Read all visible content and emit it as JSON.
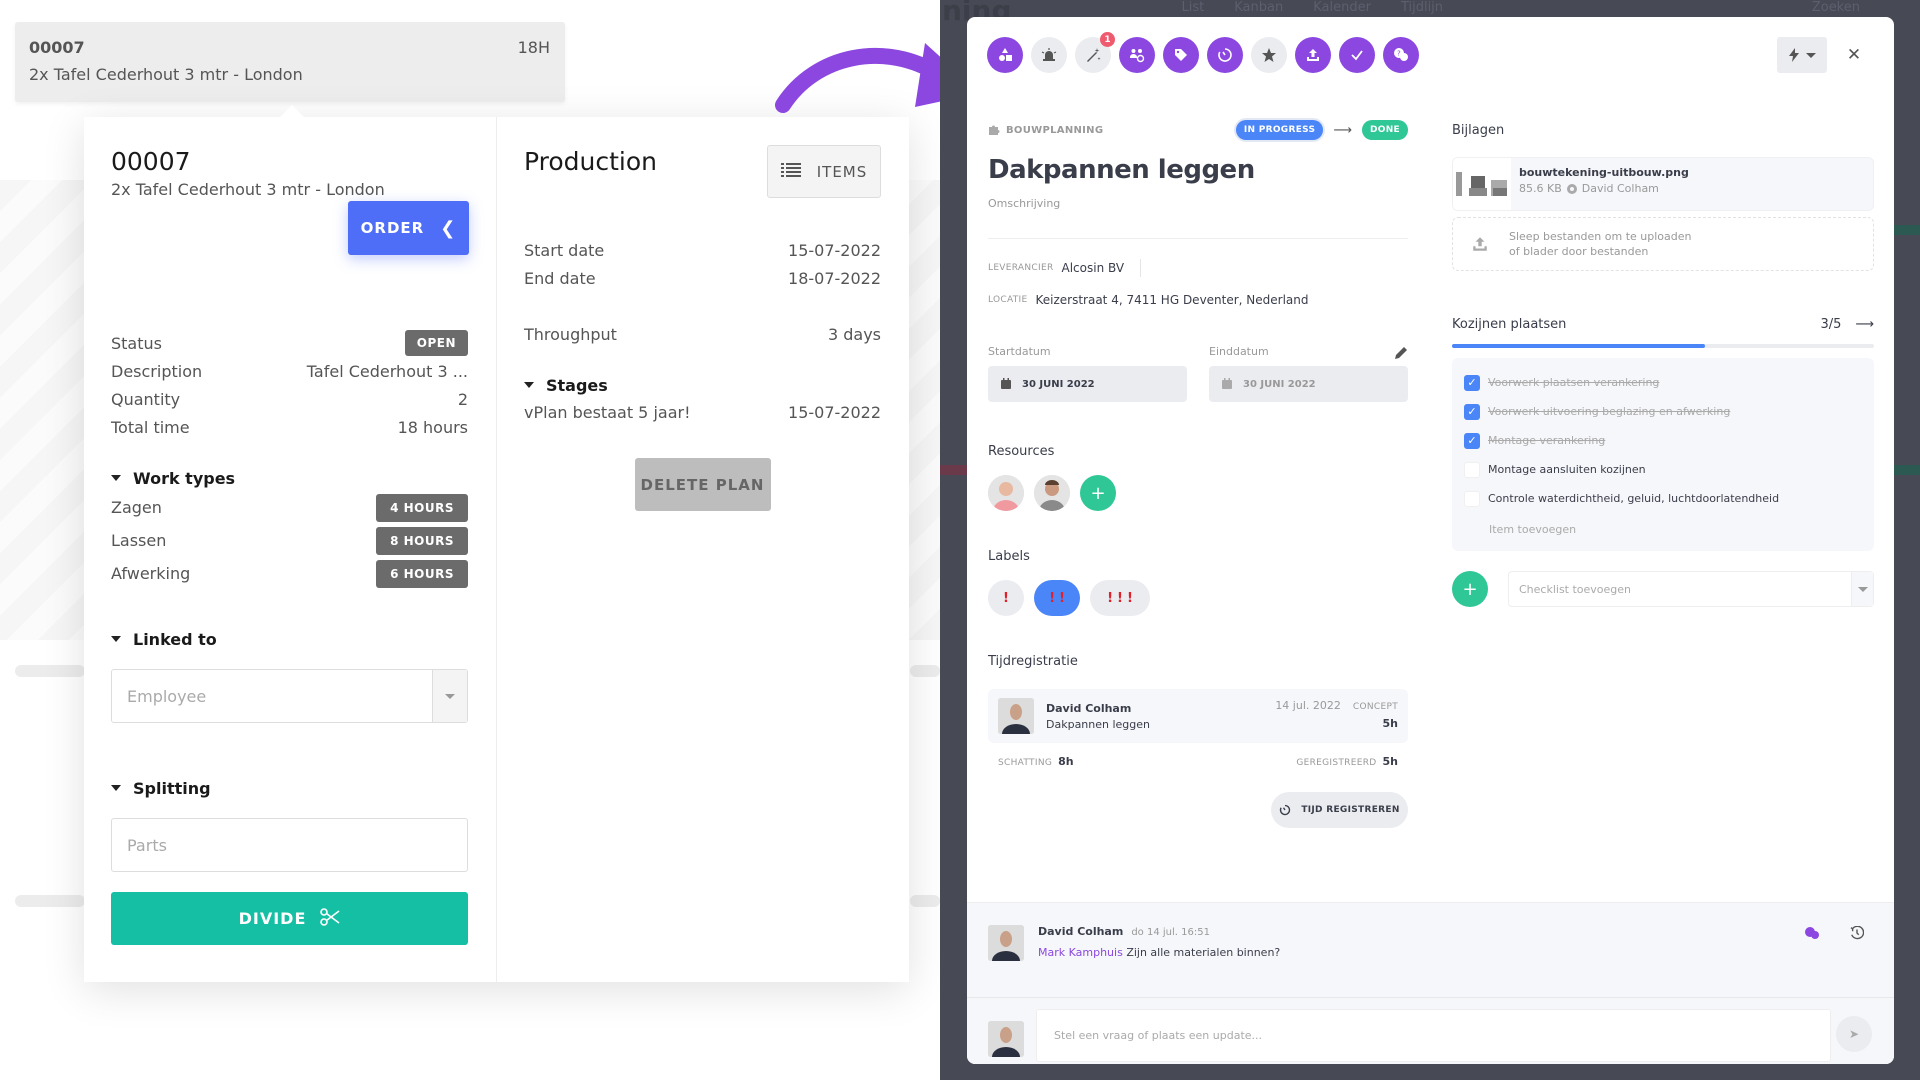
{
  "order_card": {
    "number": "00007",
    "hours": "18H",
    "description": "2x Tafel Cederhout 3 mtr - London"
  },
  "order_detail": {
    "number": "00007",
    "subtitle": "2x Tafel Cederhout 3 mtr - London",
    "order_button": "ORDER",
    "fields": [
      {
        "label": "Status",
        "value": "OPEN",
        "type": "badge"
      },
      {
        "label": "Description",
        "value": "Tafel Cederhout 3 ..."
      },
      {
        "label": "Quantity",
        "value": "2"
      },
      {
        "label": "Total time",
        "value": "18 hours"
      }
    ],
    "work_types": {
      "title": "Work types",
      "items": [
        {
          "name": "Zagen",
          "hours": "4 HOURS"
        },
        {
          "name": "Lassen",
          "hours": "8 HOURS"
        },
        {
          "name": "Afwerking",
          "hours": "6 HOURS"
        }
      ]
    },
    "linked_to": {
      "title": "Linked to",
      "placeholder": "Employee"
    },
    "splitting": {
      "title": "Splitting",
      "placeholder": "Parts",
      "button": "DIVIDE"
    }
  },
  "production": {
    "title": "Production",
    "items_button": "ITEMS",
    "start_label": "Start date",
    "start_value": "15-07-2022",
    "end_label": "End date",
    "end_value": "18-07-2022",
    "throughput_label": "Throughput",
    "throughput_value": "3 days",
    "stages": {
      "title": "Stages",
      "items": [
        {
          "name": "vPlan bestaat 5 jaar!",
          "date": "15-07-2022"
        }
      ]
    },
    "delete_button": "DELETE PLAN"
  },
  "background_app": {
    "logo_fragment": "ning",
    "nav": [
      "List",
      "Kanban",
      "Kalender",
      "Tijdlijn"
    ],
    "search": "Zoeken"
  },
  "task_modal": {
    "toolbar": [
      {
        "icon": "shapes-icon",
        "style": "purple"
      },
      {
        "icon": "siren-icon",
        "style": "grey"
      },
      {
        "icon": "magic-wand-icon",
        "style": "grey",
        "badge": "1"
      },
      {
        "icon": "users-settings-icon",
        "style": "purple"
      },
      {
        "icon": "tag-icon",
        "style": "purple"
      },
      {
        "icon": "timer-icon",
        "style": "purple"
      },
      {
        "icon": "star-icon",
        "style": "grey"
      },
      {
        "icon": "upload-icon",
        "style": "purple"
      },
      {
        "icon": "check-icon",
        "style": "purple"
      },
      {
        "icon": "chat-question-icon",
        "style": "purple"
      }
    ],
    "breadcrumb": "BOUWPLANNING",
    "status_current": "IN PROGRESS",
    "status_next": "DONE",
    "title": "Dakpannen leggen",
    "description_placeholder": "Omschrijving",
    "leverancier_label": "LEVERANCIER",
    "leverancier_value": "Alcosin BV",
    "locatie_label": "LOCATIE",
    "locatie_value": "Keizerstraat 4, 7411 HG Deventer, Nederland",
    "start_label": "Startdatum",
    "start_value": "30 JUNI 2022",
    "end_label": "Einddatum",
    "end_value": "30 JUNI 2022",
    "resources_title": "Resources",
    "labels_title": "Labels",
    "labels": [
      "!",
      "!!",
      "!!!"
    ],
    "active_label_index": 1,
    "time_title": "Tijdregistratie",
    "time_entry": {
      "name": "David Colham",
      "task": "Dakpannen leggen",
      "date": "14 jul. 2022",
      "status": "CONCEPT",
      "hours": "5h"
    },
    "estimate_label": "SCHATTING",
    "estimate_value": "8h",
    "registered_label": "GEREGISTREERD",
    "registered_value": "5h",
    "register_button": "TIJD REGISTREREN",
    "attachments_title": "Bijlagen",
    "attachment": {
      "name": "bouwtekening-uitbouw.png",
      "size": "85.6 KB",
      "owner": "David Colham"
    },
    "dropzone_line1": "Sleep bestanden om te uploaden",
    "dropzone_line2": "of blader door bestanden",
    "checklist": {
      "title": "Kozijnen plaatsen",
      "count": "3/5",
      "progress": 0.6,
      "items": [
        {
          "text": "Voorwerk plaatsen verankering",
          "done": true
        },
        {
          "text": "Voorwerk uitvoering beglazing en afwerking",
          "done": true
        },
        {
          "text": "Montage verankering",
          "done": true
        },
        {
          "text": "Montage aansluiten kozijnen",
          "done": false
        },
        {
          "text": "Controle waterdichtheid, geluid, luchtdoorlatendheid",
          "done": false
        }
      ],
      "add_item": "Item toevoegen"
    },
    "add_checklist_placeholder": "Checklist toevoegen",
    "comment": {
      "author": "David Colham",
      "time": "do 14 jul. 16:51",
      "mention": "Mark Kamphuis",
      "text": "Zijn alle materialen binnen?"
    },
    "reply_placeholder": "Stel een vraag of plaats een update..."
  },
  "colors": {
    "purple": "#8b47e0",
    "order_blue": "#4f6ef7",
    "teal": "#14bfa4",
    "status_blue": "#4a86f7",
    "status_green": "#2fc795"
  }
}
